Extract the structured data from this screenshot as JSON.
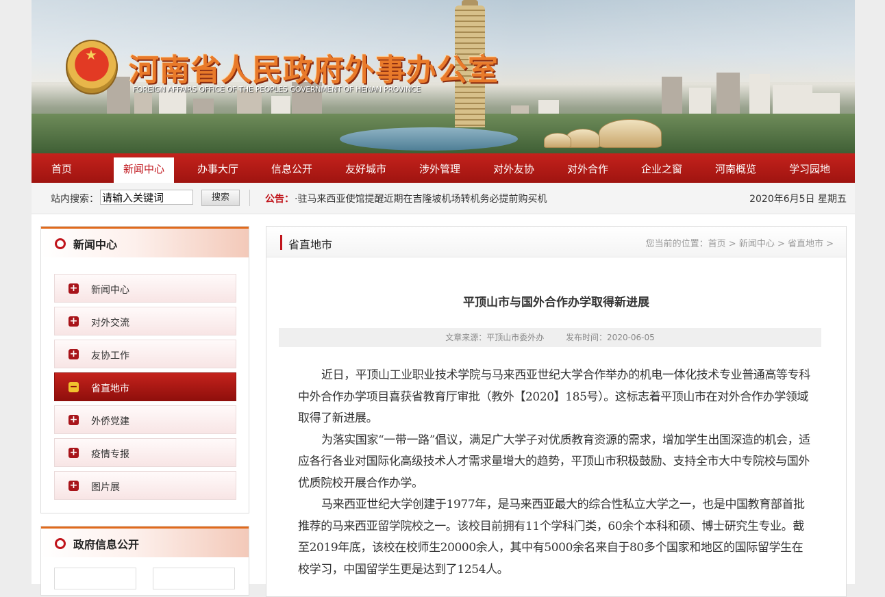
{
  "site": {
    "title": "河南省人民政府外事办公室",
    "subtitle": "FOREIGN AFFAIRS OFFICE OF THE PEOPLES GOVERNMENT OF HENAN PROVINCE"
  },
  "nav": [
    {
      "label": "首页"
    },
    {
      "label": "新闻中心"
    },
    {
      "label": "办事大厅"
    },
    {
      "label": "信息公开"
    },
    {
      "label": "友好城市"
    },
    {
      "label": "涉外管理"
    },
    {
      "label": "对外友协"
    },
    {
      "label": "对外合作"
    },
    {
      "label": "企业之窗"
    },
    {
      "label": "河南概览"
    },
    {
      "label": "学习园地"
    }
  ],
  "nav_active": "新闻中心",
  "search": {
    "label": "站内搜索：",
    "value": "请输入关键词",
    "button": "搜索"
  },
  "notice": {
    "label": "公告：",
    "text": "·驻马来西亚使馆提醒近期在吉隆坡机场转机务必提前购买机"
  },
  "date": "2020年6月5日 星期五",
  "sidebar": {
    "title": "新闻中心",
    "items": [
      {
        "label": "新闻中心",
        "icon": "plus-icon"
      },
      {
        "label": "对外交流",
        "icon": "plus-icon"
      },
      {
        "label": "友协工作",
        "icon": "plus-icon"
      },
      {
        "label": "省直地市",
        "icon": "minus-icon",
        "active": true
      },
      {
        "label": "外侨党建",
        "icon": "plus-icon"
      },
      {
        "label": "疫情专报",
        "icon": "plus-icon"
      },
      {
        "label": "图片展",
        "icon": "plus-icon"
      }
    ],
    "second_title": "政府信息公开"
  },
  "main": {
    "section": "省直地市",
    "breadcrumb": "您当前的位置：首页 > 新闻中心 > 省直地市 >",
    "article": {
      "title": "平顶山市与国外合作办学取得新进展",
      "source": "文章来源：平顶山市委外办",
      "time": "发布时间：2020-06-05",
      "paragraphs": [
        "近日，平顶山工业职业技术学院与马来西亚世纪大学合作举办的机电一体化技术专业普通高等专科中外合作办学项目喜获省教育厅审批（教外【2020】185号）。这标志着平顶山市在对外合作办学领域取得了新进展。",
        "为落实国家“一带一路”倡议，满足广大学子对优质教育资源的需求，增加学生出国深造的机会，适应各行各业对国际化高级技术人才需求量增大的趋势，平顶山市积极鼓励、支持全市大中专院校与国外优质院校开展合作办学。",
        "马来西亚世纪大学创建于1977年，是马来西亚最大的综合性私立大学之一，也是中国教育部首批推荐的马来西亚留学院校之一。该校目前拥有11个学科门类，60余个本科和硕、博士研究生专业。截至2019年底，该校在校师生20000余人，其中有5000余名来自于80多个国家和地区的国际留学生在校学习，中国留学生更是达到了1254人。"
      ]
    }
  }
}
